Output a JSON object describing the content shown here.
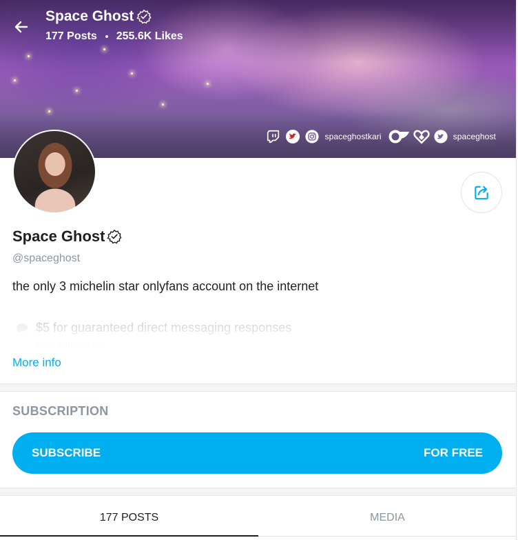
{
  "header": {
    "title": "Space Ghost",
    "posts": "177 Posts",
    "likes": "255.6K Likes"
  },
  "socials": {
    "icons": [
      "twitch-icon",
      "twitter-icon",
      "instagram-icon",
      "onlyfans-icon",
      "hearts-icon",
      "twitter-icon"
    ],
    "instagram_handle": "spaceghostkari",
    "twitter_handle": "spaceghost"
  },
  "profile": {
    "name": "Space Ghost",
    "username": "@spaceghost",
    "bio": "the only 3 michelin star onlyfans account on the internet",
    "perks": [
      "$5 for guaranteed direct messaging responses",
      "$20 slide the"
    ],
    "more_info": "More info"
  },
  "subscription": {
    "heading": "SUBSCRIPTION",
    "button_label": "SUBSCRIBE",
    "button_price": "FOR FREE"
  },
  "tabs": [
    {
      "label": "177 POSTS",
      "active": true
    },
    {
      "label": "MEDIA",
      "active": false
    }
  ],
  "colors": {
    "accent": "#00aff0",
    "muted": "#8a96a3",
    "text": "#222222"
  }
}
